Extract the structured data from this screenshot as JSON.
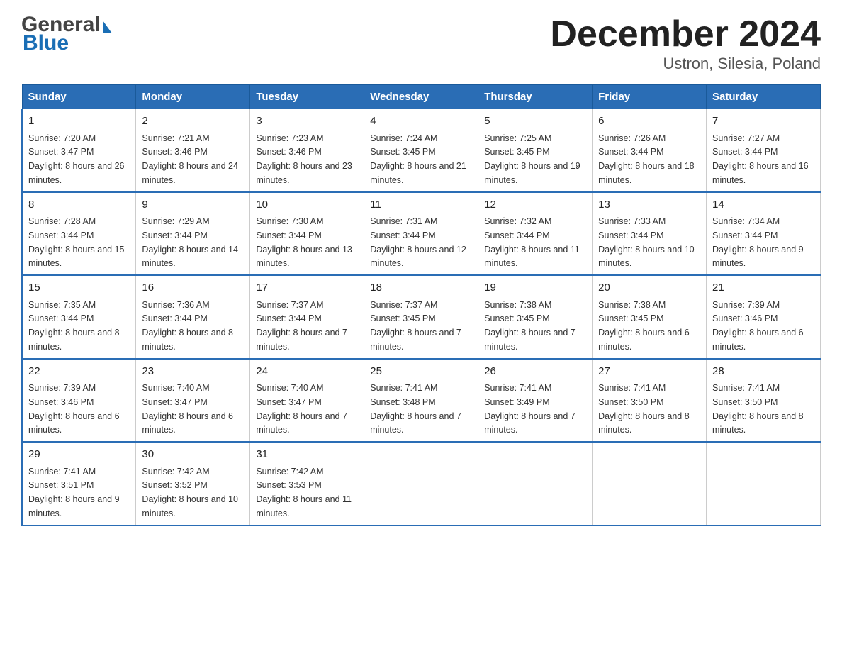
{
  "header": {
    "logo_general": "General",
    "logo_blue": "Blue",
    "month_title": "December 2024",
    "subtitle": "Ustron, Silesia, Poland"
  },
  "days_of_week": [
    "Sunday",
    "Monday",
    "Tuesday",
    "Wednesday",
    "Thursday",
    "Friday",
    "Saturday"
  ],
  "weeks": [
    [
      {
        "day": "1",
        "sunrise": "Sunrise: 7:20 AM",
        "sunset": "Sunset: 3:47 PM",
        "daylight": "Daylight: 8 hours and 26 minutes."
      },
      {
        "day": "2",
        "sunrise": "Sunrise: 7:21 AM",
        "sunset": "Sunset: 3:46 PM",
        "daylight": "Daylight: 8 hours and 24 minutes."
      },
      {
        "day": "3",
        "sunrise": "Sunrise: 7:23 AM",
        "sunset": "Sunset: 3:46 PM",
        "daylight": "Daylight: 8 hours and 23 minutes."
      },
      {
        "day": "4",
        "sunrise": "Sunrise: 7:24 AM",
        "sunset": "Sunset: 3:45 PM",
        "daylight": "Daylight: 8 hours and 21 minutes."
      },
      {
        "day": "5",
        "sunrise": "Sunrise: 7:25 AM",
        "sunset": "Sunset: 3:45 PM",
        "daylight": "Daylight: 8 hours and 19 minutes."
      },
      {
        "day": "6",
        "sunrise": "Sunrise: 7:26 AM",
        "sunset": "Sunset: 3:44 PM",
        "daylight": "Daylight: 8 hours and 18 minutes."
      },
      {
        "day": "7",
        "sunrise": "Sunrise: 7:27 AM",
        "sunset": "Sunset: 3:44 PM",
        "daylight": "Daylight: 8 hours and 16 minutes."
      }
    ],
    [
      {
        "day": "8",
        "sunrise": "Sunrise: 7:28 AM",
        "sunset": "Sunset: 3:44 PM",
        "daylight": "Daylight: 8 hours and 15 minutes."
      },
      {
        "day": "9",
        "sunrise": "Sunrise: 7:29 AM",
        "sunset": "Sunset: 3:44 PM",
        "daylight": "Daylight: 8 hours and 14 minutes."
      },
      {
        "day": "10",
        "sunrise": "Sunrise: 7:30 AM",
        "sunset": "Sunset: 3:44 PM",
        "daylight": "Daylight: 8 hours and 13 minutes."
      },
      {
        "day": "11",
        "sunrise": "Sunrise: 7:31 AM",
        "sunset": "Sunset: 3:44 PM",
        "daylight": "Daylight: 8 hours and 12 minutes."
      },
      {
        "day": "12",
        "sunrise": "Sunrise: 7:32 AM",
        "sunset": "Sunset: 3:44 PM",
        "daylight": "Daylight: 8 hours and 11 minutes."
      },
      {
        "day": "13",
        "sunrise": "Sunrise: 7:33 AM",
        "sunset": "Sunset: 3:44 PM",
        "daylight": "Daylight: 8 hours and 10 minutes."
      },
      {
        "day": "14",
        "sunrise": "Sunrise: 7:34 AM",
        "sunset": "Sunset: 3:44 PM",
        "daylight": "Daylight: 8 hours and 9 minutes."
      }
    ],
    [
      {
        "day": "15",
        "sunrise": "Sunrise: 7:35 AM",
        "sunset": "Sunset: 3:44 PM",
        "daylight": "Daylight: 8 hours and 8 minutes."
      },
      {
        "day": "16",
        "sunrise": "Sunrise: 7:36 AM",
        "sunset": "Sunset: 3:44 PM",
        "daylight": "Daylight: 8 hours and 8 minutes."
      },
      {
        "day": "17",
        "sunrise": "Sunrise: 7:37 AM",
        "sunset": "Sunset: 3:44 PM",
        "daylight": "Daylight: 8 hours and 7 minutes."
      },
      {
        "day": "18",
        "sunrise": "Sunrise: 7:37 AM",
        "sunset": "Sunset: 3:45 PM",
        "daylight": "Daylight: 8 hours and 7 minutes."
      },
      {
        "day": "19",
        "sunrise": "Sunrise: 7:38 AM",
        "sunset": "Sunset: 3:45 PM",
        "daylight": "Daylight: 8 hours and 7 minutes."
      },
      {
        "day": "20",
        "sunrise": "Sunrise: 7:38 AM",
        "sunset": "Sunset: 3:45 PM",
        "daylight": "Daylight: 8 hours and 6 minutes."
      },
      {
        "day": "21",
        "sunrise": "Sunrise: 7:39 AM",
        "sunset": "Sunset: 3:46 PM",
        "daylight": "Daylight: 8 hours and 6 minutes."
      }
    ],
    [
      {
        "day": "22",
        "sunrise": "Sunrise: 7:39 AM",
        "sunset": "Sunset: 3:46 PM",
        "daylight": "Daylight: 8 hours and 6 minutes."
      },
      {
        "day": "23",
        "sunrise": "Sunrise: 7:40 AM",
        "sunset": "Sunset: 3:47 PM",
        "daylight": "Daylight: 8 hours and 6 minutes."
      },
      {
        "day": "24",
        "sunrise": "Sunrise: 7:40 AM",
        "sunset": "Sunset: 3:47 PM",
        "daylight": "Daylight: 8 hours and 7 minutes."
      },
      {
        "day": "25",
        "sunrise": "Sunrise: 7:41 AM",
        "sunset": "Sunset: 3:48 PM",
        "daylight": "Daylight: 8 hours and 7 minutes."
      },
      {
        "day": "26",
        "sunrise": "Sunrise: 7:41 AM",
        "sunset": "Sunset: 3:49 PM",
        "daylight": "Daylight: 8 hours and 7 minutes."
      },
      {
        "day": "27",
        "sunrise": "Sunrise: 7:41 AM",
        "sunset": "Sunset: 3:50 PM",
        "daylight": "Daylight: 8 hours and 8 minutes."
      },
      {
        "day": "28",
        "sunrise": "Sunrise: 7:41 AM",
        "sunset": "Sunset: 3:50 PM",
        "daylight": "Daylight: 8 hours and 8 minutes."
      }
    ],
    [
      {
        "day": "29",
        "sunrise": "Sunrise: 7:41 AM",
        "sunset": "Sunset: 3:51 PM",
        "daylight": "Daylight: 8 hours and 9 minutes."
      },
      {
        "day": "30",
        "sunrise": "Sunrise: 7:42 AM",
        "sunset": "Sunset: 3:52 PM",
        "daylight": "Daylight: 8 hours and 10 minutes."
      },
      {
        "day": "31",
        "sunrise": "Sunrise: 7:42 AM",
        "sunset": "Sunset: 3:53 PM",
        "daylight": "Daylight: 8 hours and 11 minutes."
      },
      null,
      null,
      null,
      null
    ]
  ]
}
